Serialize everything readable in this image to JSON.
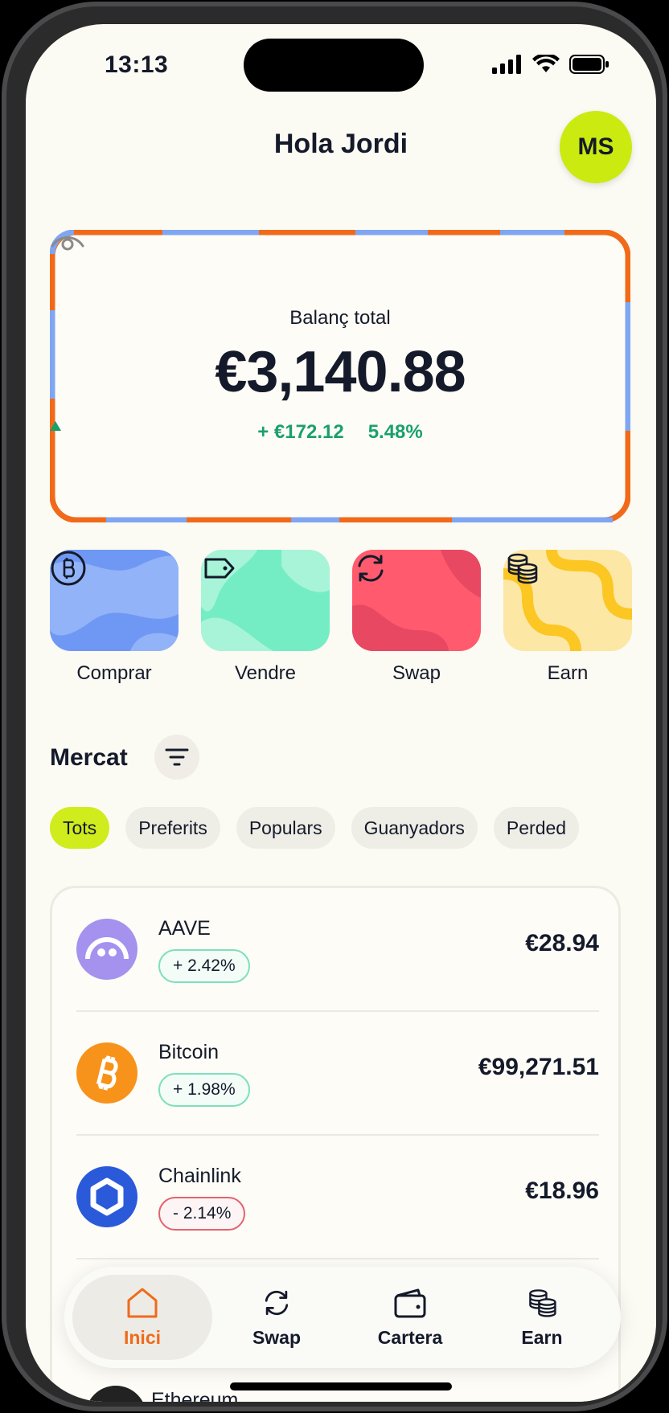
{
  "status_bar": {
    "time": "13:13"
  },
  "header": {
    "greeting": "Hola Jordi",
    "avatar_initials": "MS"
  },
  "balance": {
    "label": "Balanç total",
    "amount": "€3,140.88",
    "change_amount": "+ €172.12",
    "change_percent": "5.48%"
  },
  "actions": [
    {
      "label": "Comprar",
      "icon": "bitcoin-coin-icon",
      "color": "#8fb0f6"
    },
    {
      "label": "Vendre",
      "icon": "price-tag-icon",
      "color": "#8df0cb"
    },
    {
      "label": "Swap",
      "icon": "swap-arrows-icon",
      "color": "#ff5b6e"
    },
    {
      "label": "Earn",
      "icon": "coins-stack-icon",
      "color": "#fde7a4"
    }
  ],
  "market": {
    "title": "Mercat",
    "filters": [
      "Tots",
      "Preferits",
      "Populars",
      "Guanyadors",
      "Perded"
    ],
    "active_filter": "Tots",
    "assets": [
      {
        "name": "AAVE",
        "change": "+ 2.42%",
        "direction": "up",
        "price": "€28.94",
        "icon": "aave-logo-icon",
        "color": "#a492ee"
      },
      {
        "name": "Bitcoin",
        "change": "+ 1.98%",
        "direction": "up",
        "price": "€99,271.51",
        "icon": "bitcoin-logo-icon",
        "color": "#f7931a"
      },
      {
        "name": "Chainlink",
        "change": "- 2.14%",
        "direction": "down",
        "price": "€18.96",
        "icon": "chainlink-logo-icon",
        "color": "#2a5ada"
      }
    ],
    "peek_asset": "Ethereum"
  },
  "bottom_nav": [
    {
      "label": "Inici",
      "icon": "home-icon",
      "active": true
    },
    {
      "label": "Swap",
      "icon": "swap-arrows-icon",
      "active": false
    },
    {
      "label": "Cartera",
      "icon": "wallet-icon",
      "active": false
    },
    {
      "label": "Earn",
      "icon": "coins-stack-icon",
      "active": false
    }
  ],
  "colors": {
    "accent_lime": "#cbea10",
    "accent_orange": "#f06a1a",
    "positive": "#1aa06b",
    "negative": "#e3646d",
    "background": "#fbfaf3"
  }
}
